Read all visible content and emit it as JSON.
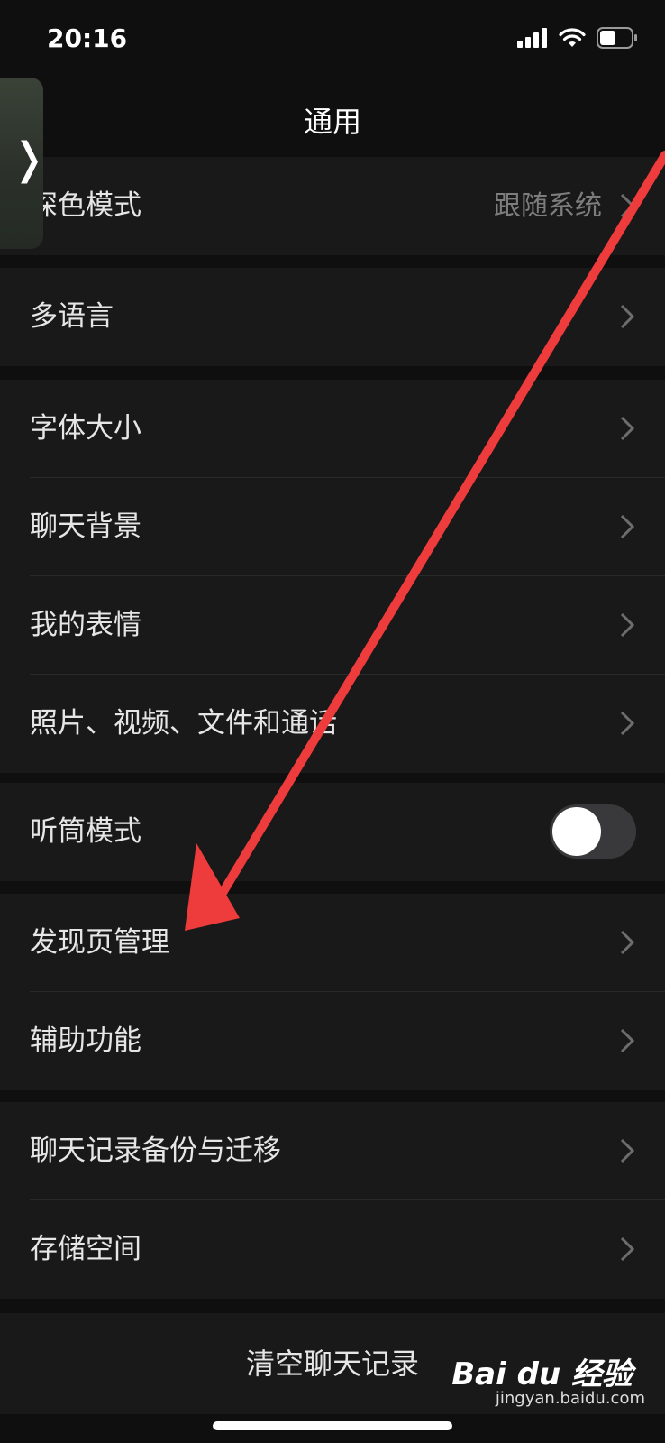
{
  "status": {
    "time": "20:16"
  },
  "nav": {
    "title": "通用"
  },
  "groups": [
    {
      "items": [
        {
          "label": "深色模式",
          "value": "跟随系统"
        }
      ]
    },
    {
      "items": [
        {
          "label": "多语言"
        }
      ]
    },
    {
      "items": [
        {
          "label": "字体大小"
        },
        {
          "label": "聊天背景"
        },
        {
          "label": "我的表情"
        },
        {
          "label": "照片、视频、文件和通话"
        }
      ]
    },
    {
      "items": [
        {
          "label": "听筒模式",
          "toggle": false
        }
      ]
    },
    {
      "items": [
        {
          "label": "发现页管理"
        },
        {
          "label": "辅助功能"
        }
      ]
    },
    {
      "items": [
        {
          "label": "聊天记录备份与迁移"
        },
        {
          "label": "存储空间"
        }
      ]
    }
  ],
  "actions": {
    "clear_chat": "清空聊天记录"
  },
  "watermark": {
    "brand": "Bai du 经验",
    "site": "jingyan.baidu.com"
  },
  "colors": {
    "background": "#0f0f0f",
    "cell": "#191919",
    "annotation_arrow": "#ee3b3b",
    "toggle_off": "#39393b"
  }
}
